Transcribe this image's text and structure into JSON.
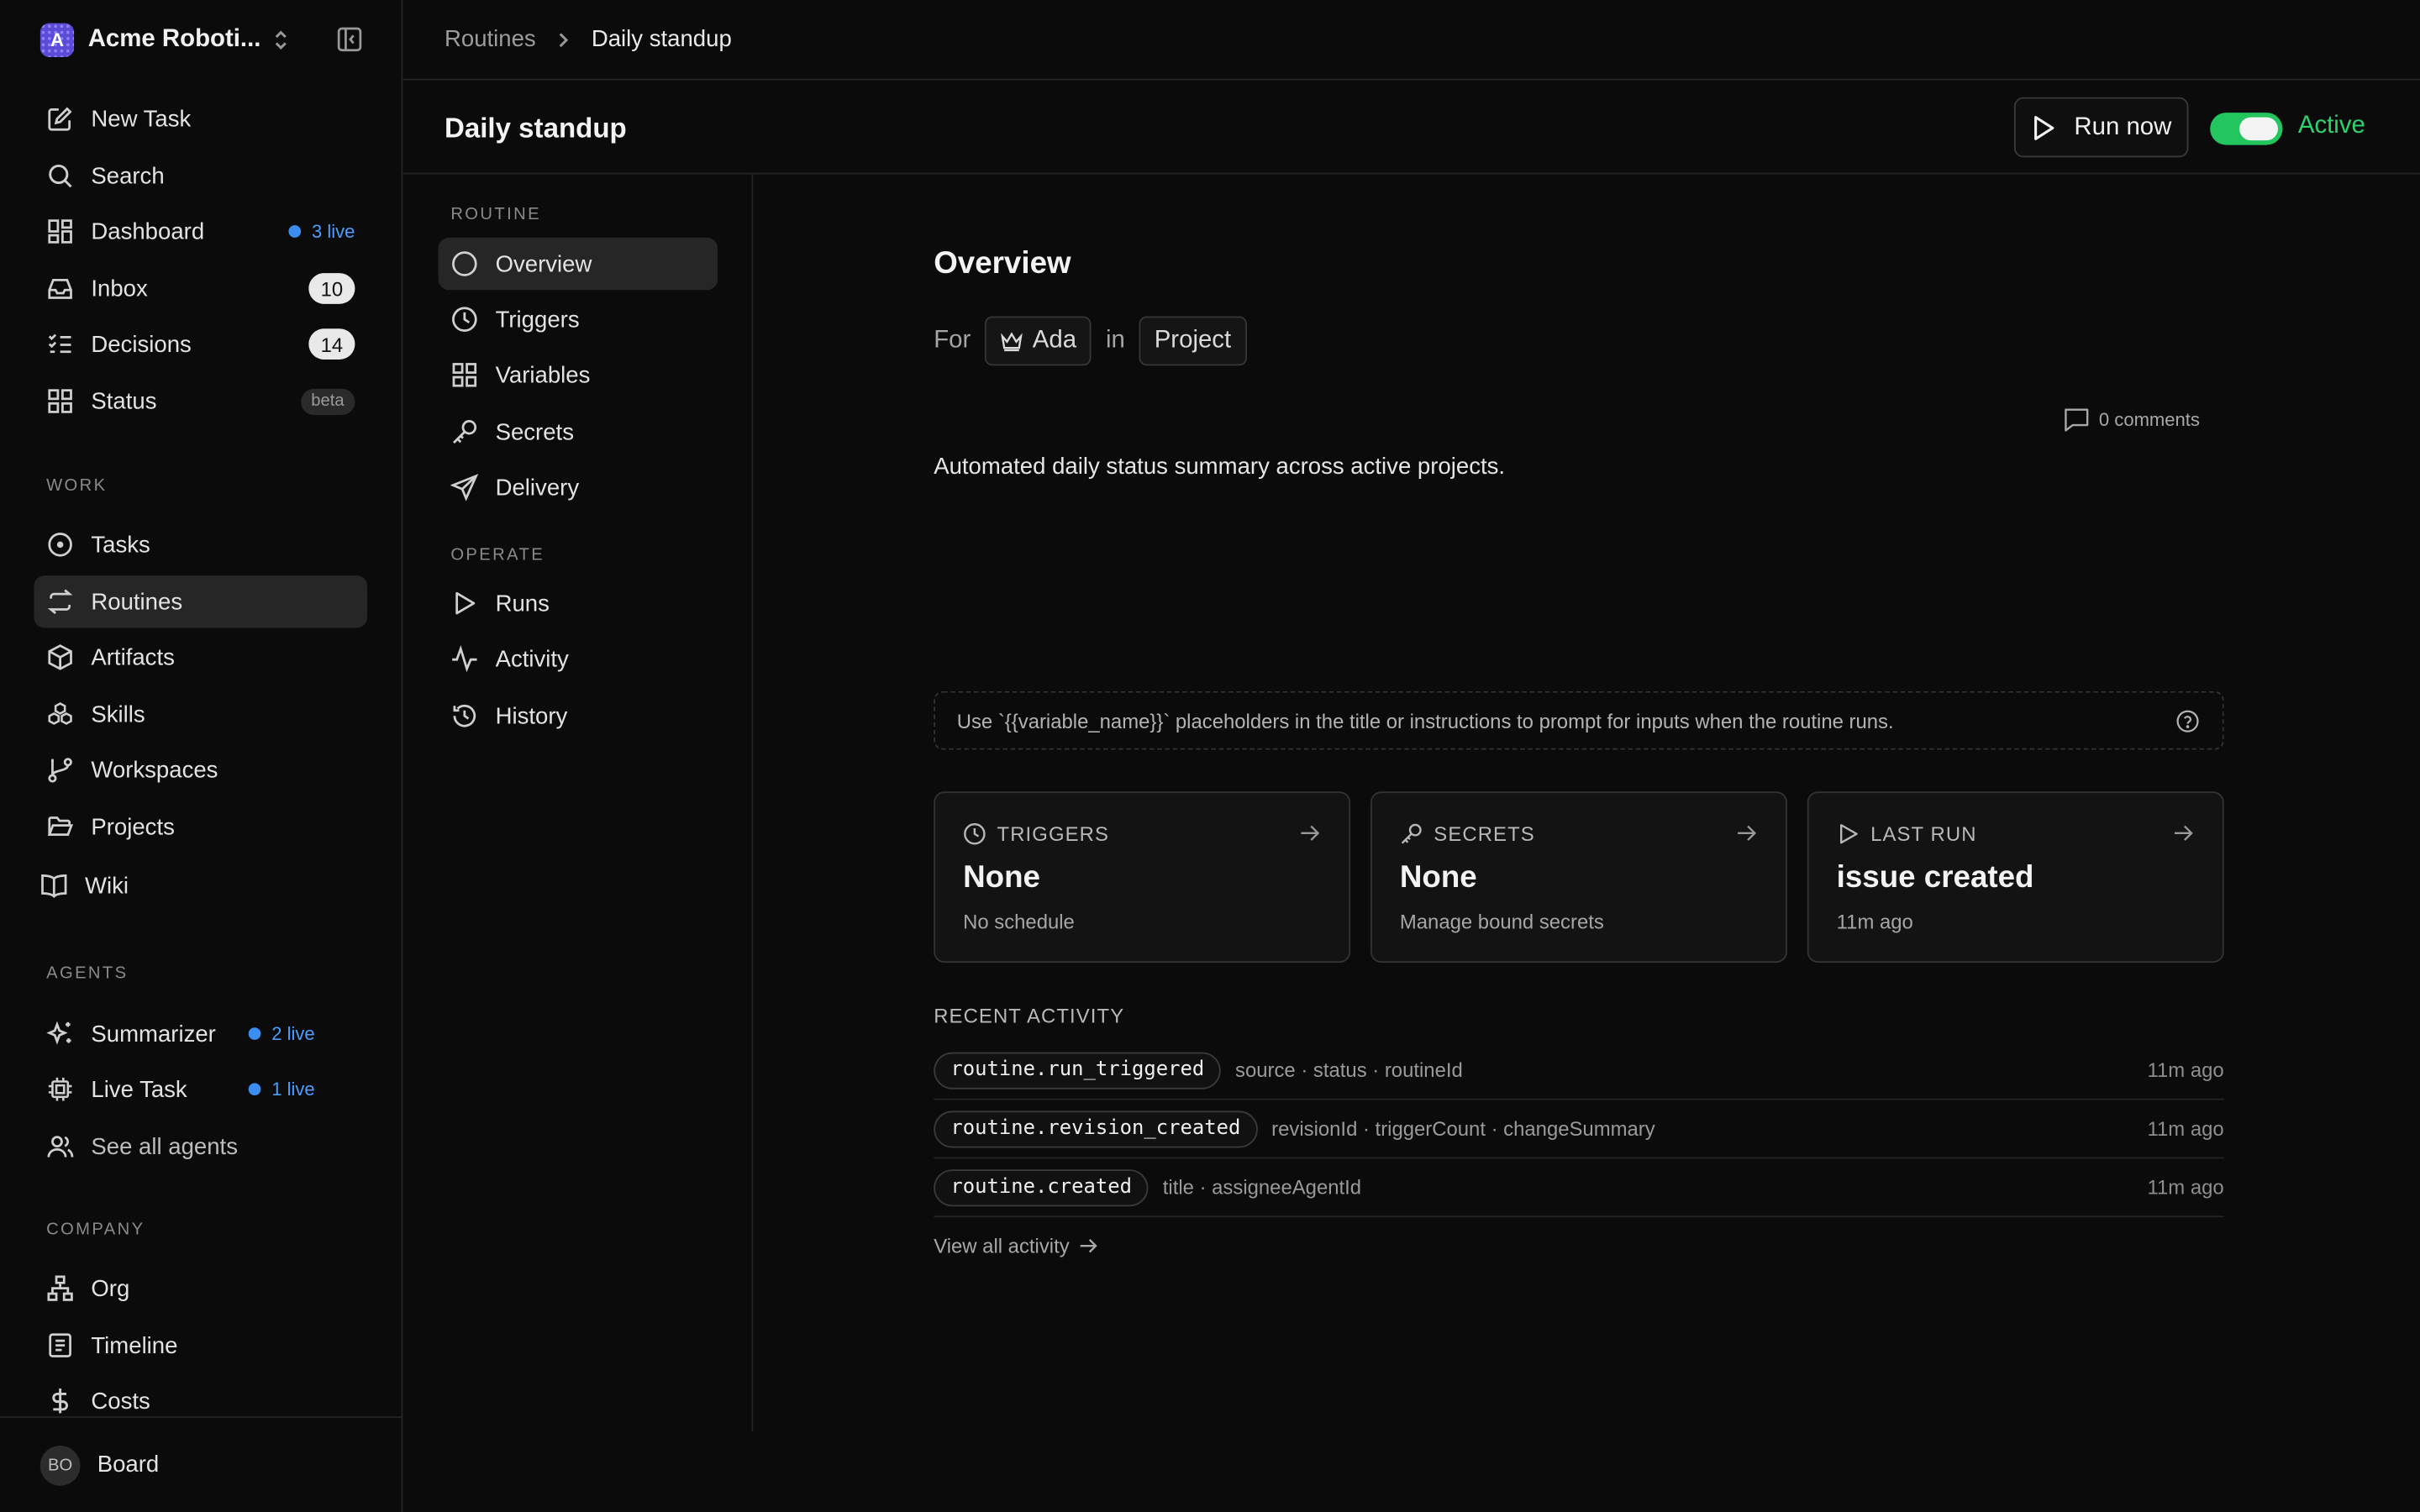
{
  "workspace": {
    "name": "Acme Roboti...",
    "logo_letter": "A"
  },
  "nav": {
    "new_task": "New Task",
    "search": "Search",
    "dashboard": "Dashboard",
    "dashboard_live": "3 live",
    "inbox": "Inbox",
    "inbox_count": "10",
    "decisions": "Decisions",
    "decisions_count": "14",
    "status": "Status",
    "status_badge": "beta"
  },
  "work": {
    "title": "WORK",
    "tasks": "Tasks",
    "routines": "Routines",
    "artifacts": "Artifacts",
    "skills": "Skills",
    "workspaces": "Workspaces",
    "projects": "Projects",
    "wiki": "Wiki"
  },
  "agents": {
    "title": "AGENTS",
    "summarizer": "Summarizer",
    "summarizer_live": "2 live",
    "live_task": "Live Task",
    "live_task_live": "1 live",
    "see_all": "See all agents"
  },
  "company": {
    "title": "COMPANY",
    "org": "Org",
    "timeline": "Timeline",
    "costs": "Costs"
  },
  "user": {
    "initials": "BO",
    "name": "Board"
  },
  "breadcrumb": {
    "parent": "Routines",
    "current": "Daily standup"
  },
  "header": {
    "title": "Daily standup",
    "run_label": "Run now",
    "status": "Active"
  },
  "subnav": {
    "routine_title": "ROUTINE",
    "overview": "Overview",
    "triggers": "Triggers",
    "variables": "Variables",
    "secrets": "Secrets",
    "delivery": "Delivery",
    "operate_title": "OPERATE",
    "runs": "Runs",
    "activity": "Activity",
    "history": "History"
  },
  "overview": {
    "title": "Overview",
    "for_label": "For",
    "agent": "Ada",
    "in_label": "in",
    "project": "Project",
    "comments": "0 comments",
    "description": "Automated daily status summary across active projects.",
    "hint": "Use `{{variable_name}}` placeholders in the title or instructions to prompt for inputs when the routine runs."
  },
  "cards": {
    "triggers": {
      "label": "TRIGGERS",
      "value": "None",
      "sub": "No schedule"
    },
    "secrets": {
      "label": "SECRETS",
      "value": "None",
      "sub": "Manage bound secrets"
    },
    "last_run": {
      "label": "LAST RUN",
      "value": "issue created",
      "sub": "11m ago"
    }
  },
  "activity": {
    "title": "RECENT ACTIVITY",
    "rows": [
      {
        "event": "routine.run_triggered",
        "meta": "source · status · routineId",
        "time": "11m ago"
      },
      {
        "event": "routine.revision_created",
        "meta": "revisionId · triggerCount · changeSummary",
        "time": "11m ago"
      },
      {
        "event": "routine.created",
        "meta": "title · assigneeAgentId",
        "time": "11m ago"
      }
    ],
    "view_all": "View all activity"
  },
  "colors": {
    "accent_green": "#22c55e",
    "live_blue": "#3b8ef0",
    "background": "#0b0b0b"
  }
}
